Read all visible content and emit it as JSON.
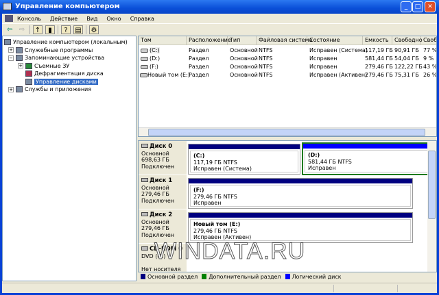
{
  "window": {
    "title": "Управление компьютером",
    "min": "_",
    "max": "□",
    "close": "✕"
  },
  "menu": [
    "Консоль",
    "Действие",
    "Вид",
    "Окно",
    "Справка"
  ],
  "tree": {
    "root": "Управление компьютером (локальным)",
    "utilities": "Служебные программы",
    "storage": "Запоминающие устройства",
    "removable": "Съемные ЗУ",
    "defrag": "Дефрагментация диска",
    "diskmgmt": "Управление дисками",
    "services": "Службы и приложения"
  },
  "columns": [
    "Том",
    "Расположение",
    "Тип",
    "Файловая система",
    "Состояние",
    "Емкость",
    "Свободно",
    "Свобо"
  ],
  "volumes": [
    [
      "(C:)",
      "Раздел",
      "Основной",
      "NTFS",
      "Исправен (Система)",
      "117,19 ГБ",
      "90,91 ГБ",
      "77 %"
    ],
    [
      "(D:)",
      "Раздел",
      "Основной",
      "NTFS",
      "Исправен",
      "581,44 ГБ",
      "54,04 ГБ",
      "9 %"
    ],
    [
      "(F:)",
      "Раздел",
      "Основной",
      "NTFS",
      "Исправен",
      "279,46 ГБ",
      "122,22 ГБ",
      "43 %"
    ],
    [
      "Новый том (E:)",
      "Раздел",
      "Основной",
      "NTFS",
      "Исправен (Активен)",
      "279,46 ГБ",
      "75,31 ГБ",
      "26 %"
    ]
  ],
  "disks": [
    {
      "name": "Диск 0",
      "type": "Основной",
      "size": "698,63 ГБ",
      "state": "Подключен"
    },
    {
      "name": "Диск 1",
      "type": "Основной",
      "size": "279,46 ГБ",
      "state": "Подключен"
    },
    {
      "name": "Диск 2",
      "type": "Основной",
      "size": "279,46 ГБ",
      "state": "Подключен"
    },
    {
      "name": "CD-ROM 0",
      "type": "DVD (G:)",
      "state": "Нет носителя"
    }
  ],
  "partitions": {
    "c": {
      "name": "(C:)",
      "size": "117,19 ГБ NTFS",
      "state": "Исправен (Система)"
    },
    "d": {
      "name": "(D:)",
      "size": "581,44 ГБ NTFS",
      "state": "Исправен"
    },
    "f": {
      "name": "(F:)",
      "size": "279,46 ГБ NTFS",
      "state": "Исправен"
    },
    "e": {
      "name": "Новый том  (E:)",
      "size": "279,46 ГБ NTFS",
      "state": "Исправен (Активен)"
    }
  },
  "legend": [
    {
      "label": "Основной раздел",
      "color": "#000080"
    },
    {
      "label": "Дополнительный раздел",
      "color": "#008000"
    },
    {
      "label": "Логический диск",
      "color": "#0000ff"
    }
  ],
  "watermark": "WINDATA.RU"
}
